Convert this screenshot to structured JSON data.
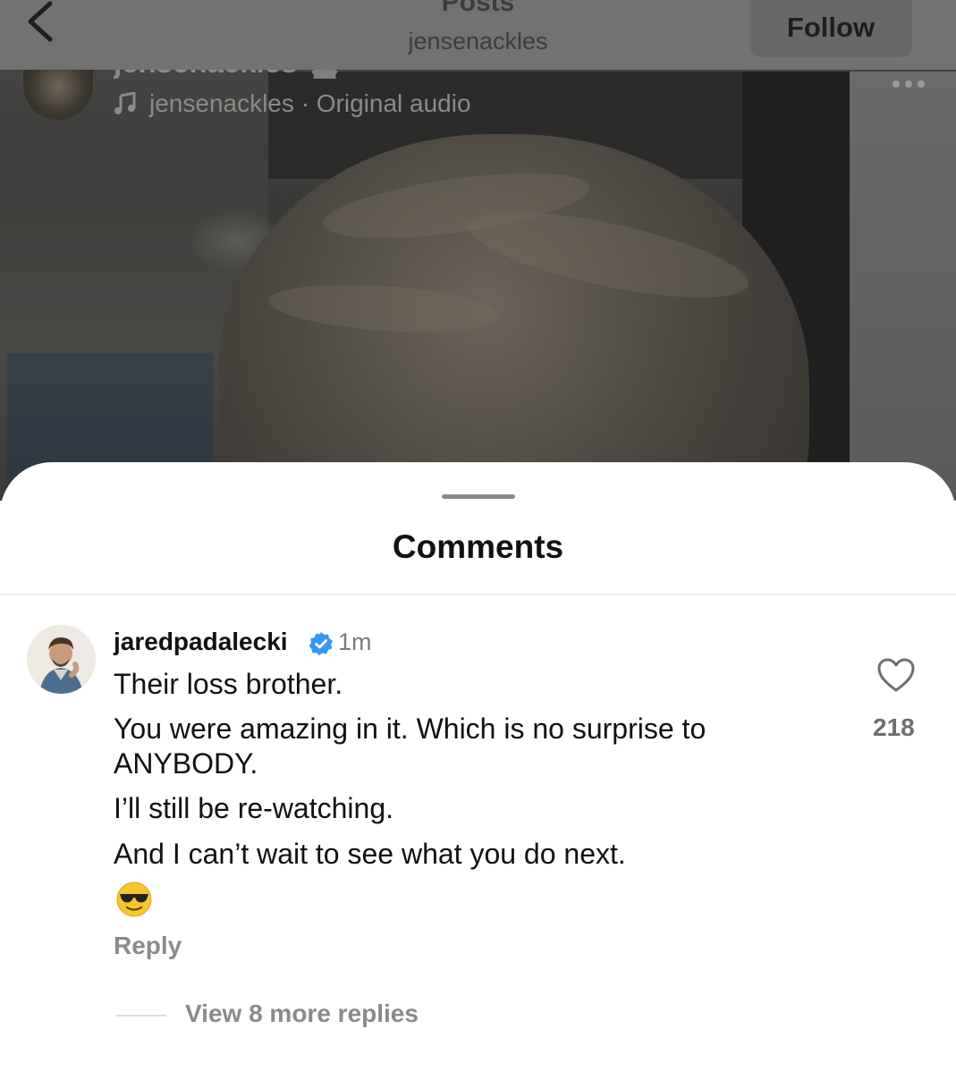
{
  "header": {
    "title": "Posts",
    "subtitle": "jensenackles",
    "follow_label": "Follow"
  },
  "post": {
    "username": "jensenackles",
    "audio_text": "jensenackles · Original audio"
  },
  "comments_sheet": {
    "title": "Comments",
    "comment": {
      "username": "jaredpadalecki",
      "time": "1m",
      "lines": [
        "Their loss brother.",
        "You were amazing in it. Which is no surprise to",
        "ANYBODY.",
        "I’ll still be re-watching.",
        "And I can’t wait to see what you do next."
      ],
      "emoji": "smiling-face-with-sunglasses",
      "like_count": "218",
      "reply_label": "Reply"
    },
    "view_replies_label": "View 8 more replies"
  },
  "colors": {
    "verified_blue": "#3897f0",
    "text_primary": "#111111",
    "text_secondary": "#8a8a8a"
  }
}
